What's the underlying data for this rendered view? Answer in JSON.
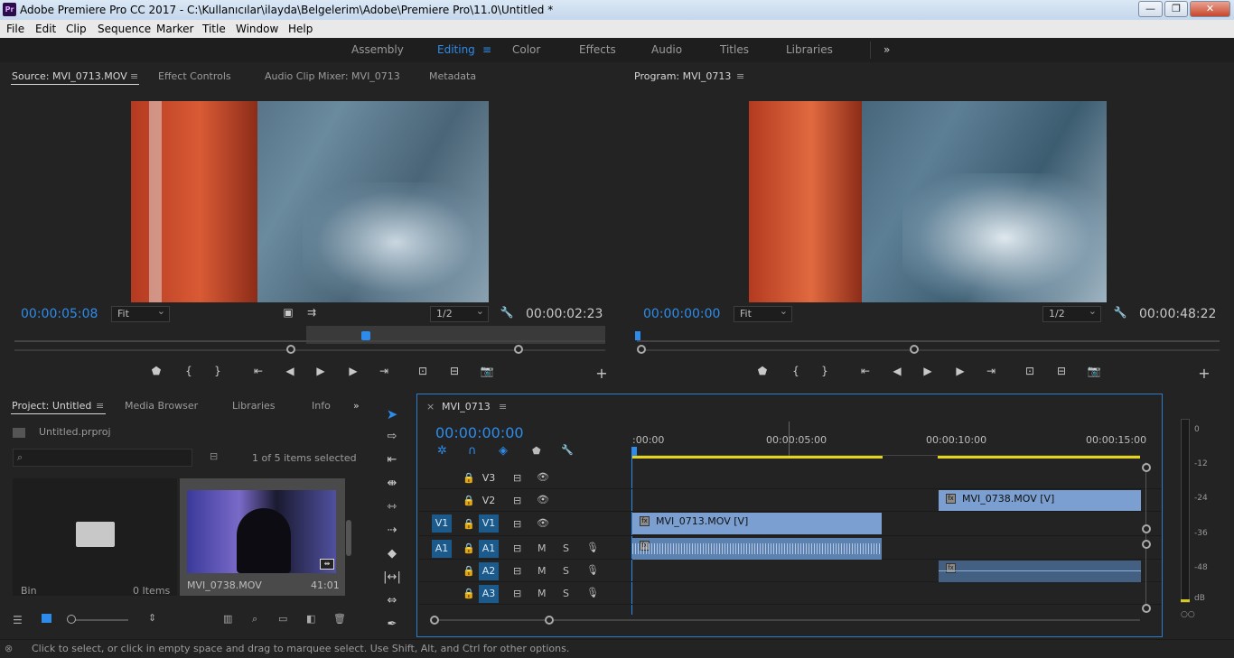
{
  "window": {
    "app_badge": "Pr",
    "title": "Adobe Premiere Pro CC 2017 - C:\\Kullanıcılar\\ilayda\\Belgelerim\\Adobe\\Premiere Pro\\11.0\\Untitled *",
    "minimize": "—",
    "maximize": "❐",
    "close": "✕"
  },
  "menu": [
    "File",
    "Edit",
    "Clip",
    "Sequence",
    "Marker",
    "Title",
    "Window",
    "Help"
  ],
  "workspaces": {
    "items": [
      "Assembly",
      "Editing",
      "Color",
      "Effects",
      "Audio",
      "Titles",
      "Libraries"
    ],
    "active": "Editing",
    "menu_icon": "≡",
    "more": "»"
  },
  "source": {
    "tabs": [
      "Source: MVI_0713.MOV",
      "Effect Controls",
      "Audio Clip Mixer: MVI_0713",
      "Metadata"
    ],
    "tab_menu": "≡",
    "timecode": "00:00:05:08",
    "fit": "Fit",
    "resolution": "1/2",
    "duration": "00:00:02:23"
  },
  "program": {
    "tab": "Program: MVI_0713",
    "tab_menu": "≡",
    "timecode": "00:00:00:00",
    "fit": "Fit",
    "resolution": "1/2",
    "duration": "00:00:48:22"
  },
  "transport": {
    "marker": "⬟",
    "in": "{",
    "out": "}",
    "goto_in": "⇤",
    "step_back": "◀",
    "play": "▶",
    "step_fwd": "▶",
    "goto_out": "⇥",
    "insert": "⊡",
    "overwrite": "⊟",
    "export": "📷",
    "add": "+"
  },
  "project": {
    "tabs": [
      "Project: Untitled",
      "Media Browser",
      "Libraries",
      "Info"
    ],
    "tab_menu": "≡",
    "more": "»",
    "file": "Untitled.prproj",
    "items_selected": "1 of 5 items selected",
    "bin_label": "Bin",
    "bin_count": "0 Items",
    "clip_name": "MVI_0738.MOV",
    "clip_duration": "41:01"
  },
  "timeline": {
    "close": "×",
    "tab": "MVI_0713",
    "tab_menu": "≡",
    "timecode": "00:00:00:00",
    "ruler": [
      ":00:00",
      "00:00:05:00",
      "00:00:10:00",
      "00:00:15:00"
    ],
    "tracks": [
      {
        "src": "",
        "name": "V3",
        "type": "video"
      },
      {
        "src": "",
        "name": "V2",
        "type": "video"
      },
      {
        "src": "V1",
        "name": "V1",
        "type": "video"
      },
      {
        "src": "A1",
        "name": "A1",
        "type": "audio"
      },
      {
        "src": "",
        "name": "A2",
        "type": "audio"
      },
      {
        "src": "",
        "name": "A3",
        "type": "audio"
      }
    ],
    "mute": "M",
    "solo": "S",
    "clips": {
      "v2": "MVI_0738.MOV [V]",
      "v1": "MVI_0713.MOV [V]"
    }
  },
  "meter": {
    "scale": [
      "0",
      "-12",
      "-24",
      "-36",
      "-48",
      "dB"
    ],
    "solo": "○○"
  },
  "status": "Click to select, or click in empty space and drag to marquee select. Use Shift, Alt, and Ctrl for other options."
}
